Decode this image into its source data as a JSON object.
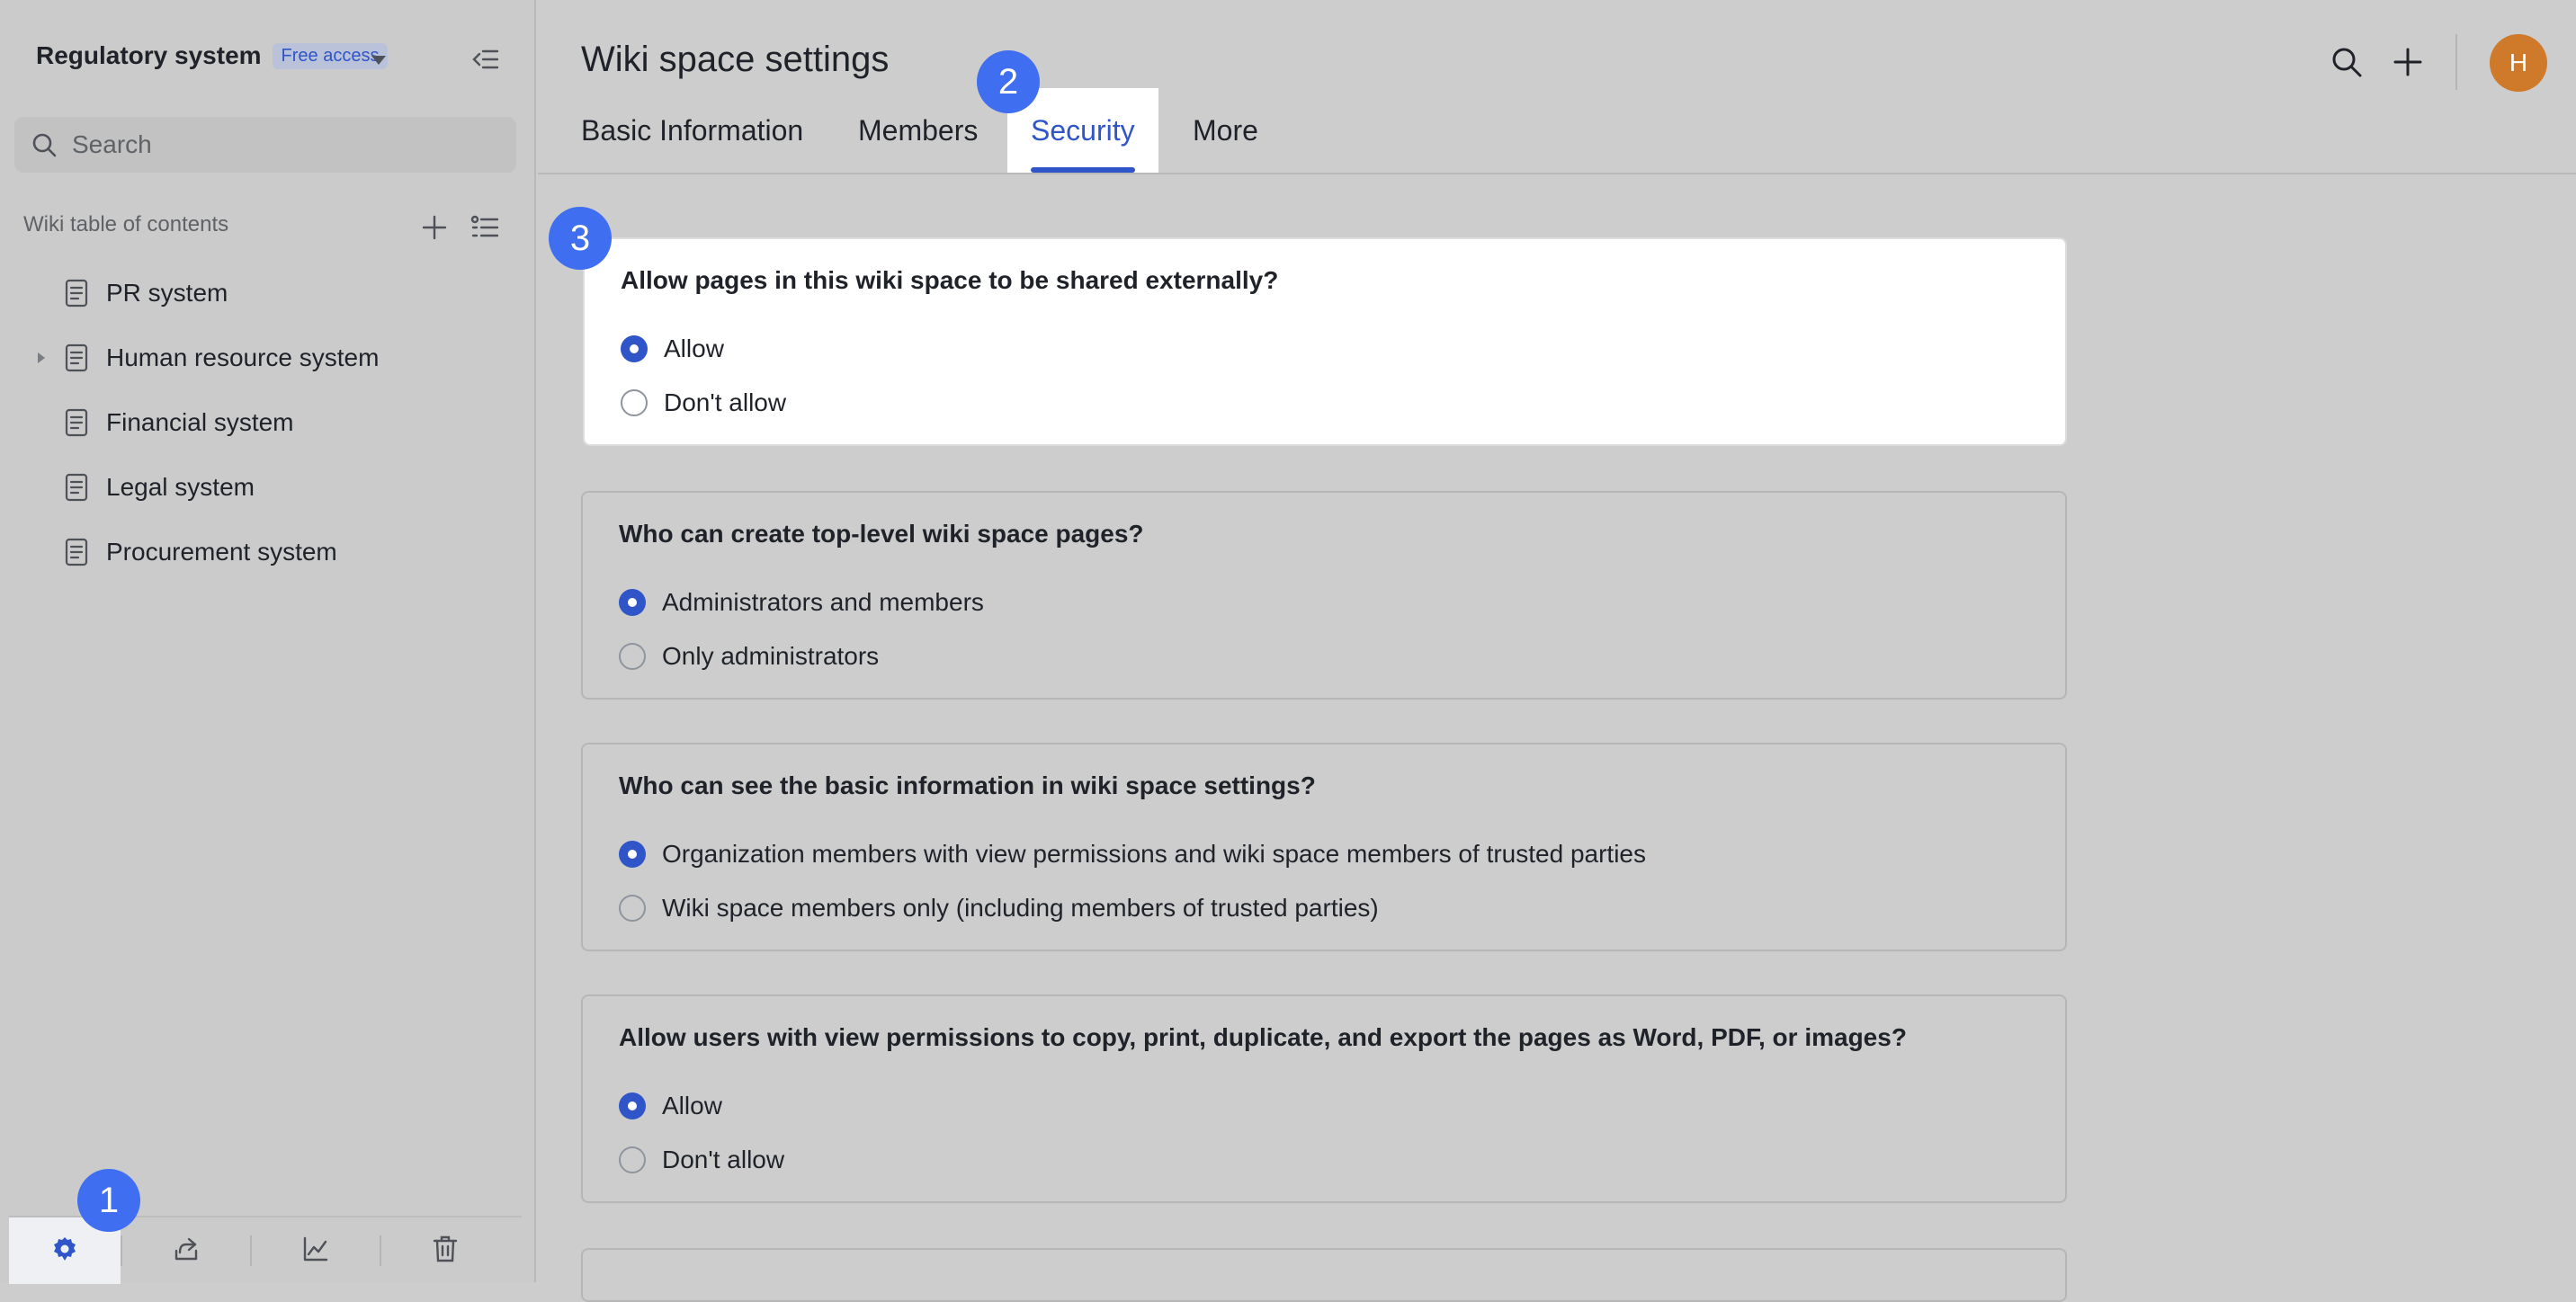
{
  "sidebar": {
    "title": "Regulatory system",
    "badge": "Free access",
    "search_placeholder": "Search",
    "toc_heading": "Wiki table of contents",
    "items": [
      {
        "label": "PR system",
        "expandable": false
      },
      {
        "label": "Human resource system",
        "expandable": true
      },
      {
        "label": "Financial system",
        "expandable": false
      },
      {
        "label": "Legal system",
        "expandable": false
      },
      {
        "label": "Procurement system",
        "expandable": false
      }
    ],
    "bottom_icons": [
      "gear-icon",
      "share-icon",
      "chart-icon",
      "trash-icon"
    ]
  },
  "header": {
    "title": "Wiki space settings",
    "avatar_initial": "H"
  },
  "tabs": [
    {
      "label": "Basic Information",
      "active": false
    },
    {
      "label": "Members",
      "active": false
    },
    {
      "label": "Security",
      "active": true
    },
    {
      "label": "More",
      "active": false
    }
  ],
  "sections": [
    {
      "question": "Allow pages in this wiki space to be shared externally?",
      "options": [
        {
          "label": "Allow",
          "selected": true
        },
        {
          "label": "Don't allow",
          "selected": false
        }
      ]
    },
    {
      "question": "Who can create top-level wiki space pages?",
      "options": [
        {
          "label": "Administrators and members",
          "selected": true
        },
        {
          "label": "Only administrators",
          "selected": false
        }
      ]
    },
    {
      "question": "Who can see the basic information in wiki space settings?",
      "options": [
        {
          "label": "Organization members with view permissions and wiki space members of trusted parties",
          "selected": true
        },
        {
          "label": "Wiki space members only (including members of trusted parties)",
          "selected": false
        }
      ]
    },
    {
      "question": "Allow users with view permissions to copy, print, duplicate, and export the pages as Word, PDF, or images?",
      "options": [
        {
          "label": "Allow",
          "selected": true
        },
        {
          "label": "Don't allow",
          "selected": false
        }
      ]
    }
  ],
  "markers": [
    "1",
    "2",
    "3"
  ],
  "colors": {
    "accent": "#2f55c8",
    "marker": "#3f6ff0",
    "avatar": "#cf7a2a",
    "overlay_bg": "#cdcdcd"
  }
}
